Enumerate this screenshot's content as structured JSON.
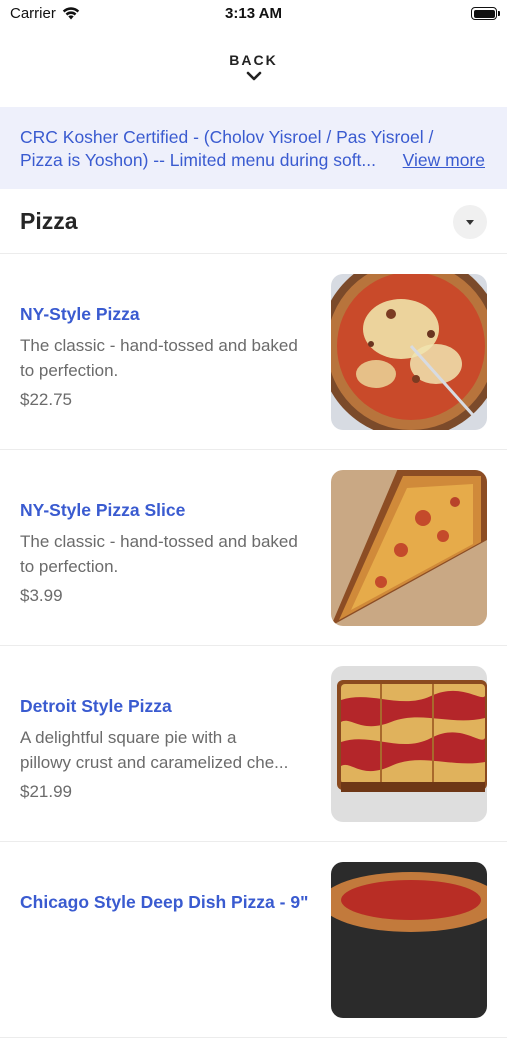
{
  "status_bar": {
    "carrier": "Carrier",
    "time": "3:13 AM"
  },
  "nav": {
    "back_label": "BACK"
  },
  "notice": {
    "line1": "CRC Kosher Certified - (Cholov Yisroel / Pas Yisroel /",
    "line2": "Pizza is Yoshon) -- Limited menu during soft...",
    "link": "View more"
  },
  "section": {
    "title": "Pizza"
  },
  "items": [
    {
      "name": "NY-Style Pizza",
      "desc_line1": "The classic - hand-tossed and baked",
      "desc_line2": "to perfection.",
      "price": "$22.75"
    },
    {
      "name": "NY-Style Pizza Slice",
      "desc_line1": "The classic - hand-tossed and baked",
      "desc_line2": "to perfection.",
      "price": "$3.99"
    },
    {
      "name": "Detroit Style Pizza",
      "desc_line1": "A delightful square pie with a",
      "desc_line2": "pillowy crust and caramelized che...",
      "price": "$21.99"
    },
    {
      "name": "Chicago Style Deep Dish Pizza - 9\"",
      "desc_line1": "",
      "desc_line2": "",
      "price": ""
    }
  ]
}
